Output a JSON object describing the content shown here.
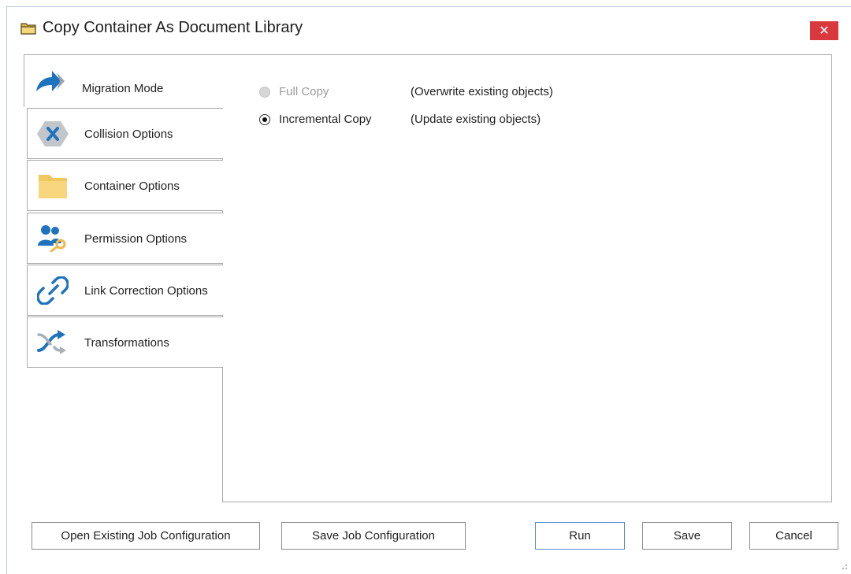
{
  "window": {
    "title": "Copy Container As Document Library",
    "close_glyph": "✕",
    "title_icon": "folder-icon"
  },
  "tabs": [
    {
      "label": "Migration Mode",
      "icon": "arrow-right-icon",
      "active": true
    },
    {
      "label": "Collision Options",
      "icon": "collision-x-icon",
      "active": false
    },
    {
      "label": "Container Options",
      "icon": "folder-icon",
      "active": false
    },
    {
      "label": "Permission Options",
      "icon": "users-key-icon",
      "active": false
    },
    {
      "label": "Link Correction Options",
      "icon": "link-icon",
      "active": false
    },
    {
      "label": "Transformations",
      "icon": "shuffle-icon",
      "active": false
    }
  ],
  "migration_mode": {
    "options": [
      {
        "label": "Full Copy",
        "description": "(Overwrite existing objects)",
        "selected": false,
        "enabled": false
      },
      {
        "label": "Incremental Copy",
        "description": "(Update existing objects)",
        "selected": true,
        "enabled": true
      }
    ]
  },
  "buttons": {
    "open_existing": "Open Existing Job Configuration",
    "save_job": "Save Job Configuration",
    "run": "Run",
    "save": "Save",
    "cancel": "Cancel"
  },
  "colors": {
    "accent_blue": "#1e73be",
    "close_red": "#d9383c",
    "folder_yellow": "#f7d67e",
    "border_gray": "#a8a8a8",
    "disabled_text": "#9a9a9a"
  }
}
